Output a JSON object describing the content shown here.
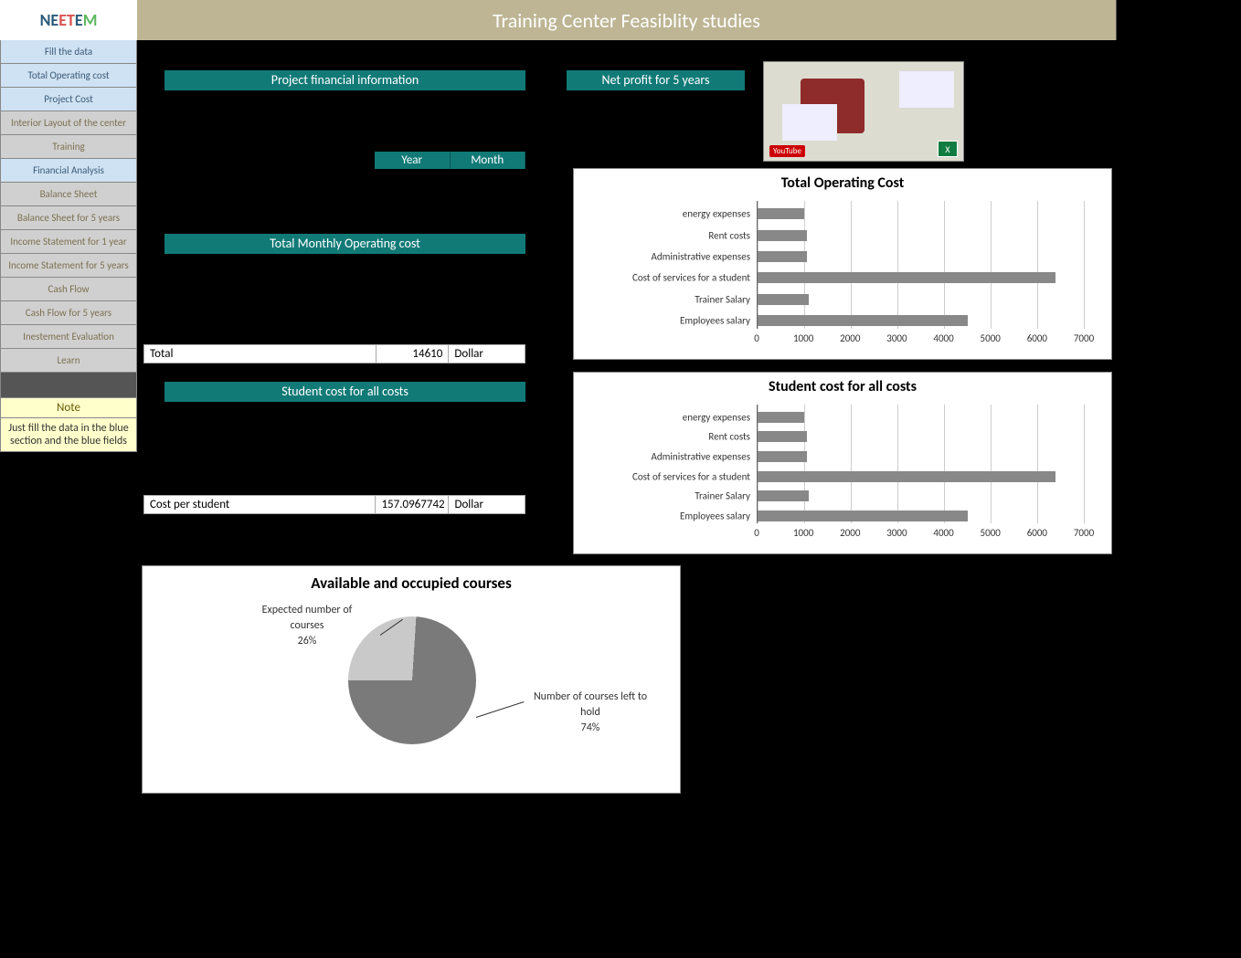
{
  "header": {
    "title": "Training Center Feasiblity studies",
    "logo": "NEETEM"
  },
  "sidebar": {
    "items": [
      {
        "label": "Fill the data",
        "cls": "sb-blue"
      },
      {
        "label": "Total  Operating cost",
        "cls": "sb-blue"
      },
      {
        "label": "Project Cost",
        "cls": "sb-blue"
      },
      {
        "label": "Interior Layout of the center",
        "cls": "sb-gray"
      },
      {
        "label": "Training",
        "cls": "sb-gray"
      },
      {
        "label": "Financial Analysis",
        "cls": "sb-blue"
      },
      {
        "label": "Balance Sheet",
        "cls": "sb-gray"
      },
      {
        "label": "Balance Sheet for 5 years",
        "cls": "sb-gray"
      },
      {
        "label": "Income Statement for 1 year",
        "cls": "sb-gray"
      },
      {
        "label": "Income Statement for 5 years",
        "cls": "sb-gray"
      },
      {
        "label": "Cash Flow",
        "cls": "sb-gray"
      },
      {
        "label": "Cash Flow for 5 years",
        "cls": "sb-gray"
      },
      {
        "label": "Inestement Evaluation",
        "cls": "sb-gray"
      },
      {
        "label": "Learn",
        "cls": "sb-gray"
      }
    ],
    "note_head": "Note",
    "note_body": "Just fill the data in the blue section and the blue fields"
  },
  "sections": {
    "proj_fin": "Project financial information",
    "net_profit": "Net profit for 5 years",
    "year": "Year",
    "month": "Month",
    "tmo": "Total Monthly Operating cost",
    "total_row": {
      "label": "Total",
      "value": "14610",
      "unit": "Dollar"
    },
    "scac": "Student cost for all costs",
    "cps_row": {
      "label": "Cost per student",
      "value": "157.0967742",
      "unit": "Dollar"
    }
  },
  "chart_data": [
    {
      "id": "toc",
      "type": "bar",
      "orientation": "horizontal",
      "title": "Total Operating Cost",
      "categories": [
        "energy expenses",
        "Rent costs",
        "Administrative expenses",
        "Cost of services for a student",
        "Trainer Salary",
        "Employees salary"
      ],
      "values": [
        1000,
        1050,
        1050,
        6400,
        1100,
        4500
      ],
      "xlim": [
        0,
        7000
      ],
      "xticks": [
        0,
        1000,
        2000,
        3000,
        4000,
        5000,
        6000,
        7000
      ]
    },
    {
      "id": "scac",
      "type": "bar",
      "orientation": "horizontal",
      "title": "Student cost for all costs",
      "categories": [
        "energy expenses",
        "Rent costs",
        "Administrative expenses",
        "Cost of services for a student",
        "Trainer Salary",
        "Employees salary"
      ],
      "values": [
        1000,
        1050,
        1050,
        6400,
        1100,
        4500
      ],
      "xlim": [
        0,
        7000
      ],
      "xticks": [
        0,
        1000,
        2000,
        3000,
        4000,
        5000,
        6000,
        7000
      ]
    },
    {
      "id": "pie",
      "type": "pie",
      "title": "Available and occupied courses",
      "slices": [
        {
          "label": "Expected number of courses",
          "pct": 26
        },
        {
          "label": "Number of courses left to hold",
          "pct": 74
        }
      ]
    }
  ],
  "thumb": {
    "yt": "YouTube",
    "xl": "X"
  }
}
